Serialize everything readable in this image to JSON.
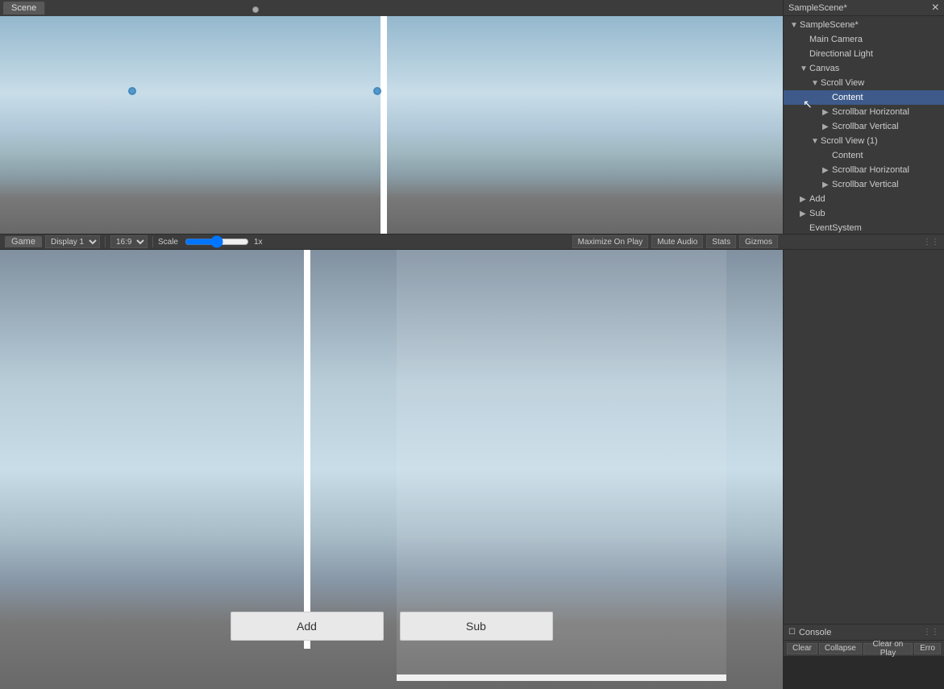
{
  "hierarchy": {
    "title": "SampleScene*",
    "items": [
      {
        "id": "sample-scene",
        "label": "SampleScene*",
        "indent": 0,
        "arrow": "▼",
        "expanded": true
      },
      {
        "id": "main-camera",
        "label": "Main Camera",
        "indent": 1,
        "arrow": "",
        "expanded": false
      },
      {
        "id": "directional-light",
        "label": "Directional Light",
        "indent": 1,
        "arrow": "",
        "expanded": false
      },
      {
        "id": "canvas",
        "label": "Canvas",
        "indent": 1,
        "arrow": "▼",
        "expanded": true
      },
      {
        "id": "scroll-view",
        "label": "Scroll View",
        "indent": 2,
        "arrow": "▼",
        "expanded": true
      },
      {
        "id": "content-1",
        "label": "Content",
        "indent": 3,
        "arrow": "",
        "expanded": false,
        "selected": true
      },
      {
        "id": "scrollbar-h-1",
        "label": "Scrollbar Horizontal",
        "indent": 3,
        "arrow": "▶",
        "expanded": false
      },
      {
        "id": "scrollbar-v-1",
        "label": "Scrollbar Vertical",
        "indent": 3,
        "arrow": "▶",
        "expanded": false
      },
      {
        "id": "scroll-view-1",
        "label": "Scroll View (1)",
        "indent": 2,
        "arrow": "▼",
        "expanded": true
      },
      {
        "id": "content-2",
        "label": "Content",
        "indent": 3,
        "arrow": "",
        "expanded": false
      },
      {
        "id": "scrollbar-h-2",
        "label": "Scrollbar Horizontal",
        "indent": 3,
        "arrow": "▶",
        "expanded": false
      },
      {
        "id": "scrollbar-v-2",
        "label": "Scrollbar Vertical",
        "indent": 3,
        "arrow": "▶",
        "expanded": false
      },
      {
        "id": "add",
        "label": "Add",
        "indent": 1,
        "arrow": "▶",
        "expanded": false
      },
      {
        "id": "sub",
        "label": "Sub",
        "indent": 1,
        "arrow": "▶",
        "expanded": false
      },
      {
        "id": "event-system",
        "label": "EventSystem",
        "indent": 1,
        "arrow": "",
        "expanded": false
      }
    ]
  },
  "scene_tab": {
    "label": "Scene"
  },
  "game_view": {
    "tab_label": "Game",
    "display_label": "Display 1",
    "aspect_label": "16:9",
    "scale_label": "Scale",
    "scale_value": "1x",
    "maximize_label": "Maximize On Play",
    "mute_label": "Mute Audio",
    "stats_label": "Stats",
    "gizmos_label": "Gizmos"
  },
  "buttons": {
    "add_label": "Add",
    "sub_label": "Sub"
  },
  "console": {
    "title": "Console",
    "clear_label": "Clear",
    "collapse_label": "Collapse",
    "clear_on_play_label": "Clear on Play",
    "error_label": "Erro"
  }
}
